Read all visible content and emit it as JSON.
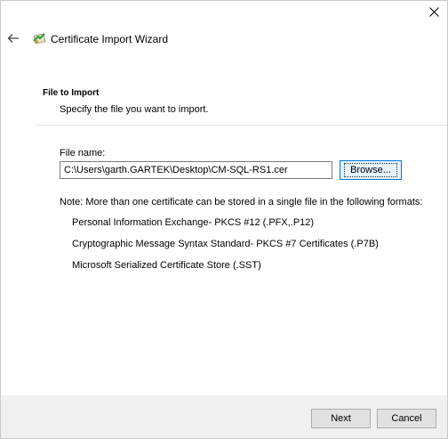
{
  "window": {
    "title": "Certificate Import Wizard"
  },
  "header": {
    "section_title": "File to Import",
    "section_subtitle": "Specify the file you want to import."
  },
  "file": {
    "label": "File name:",
    "value": "C:\\Users\\garth.GARTEK\\Desktop\\CM-SQL-RS1.cer",
    "browse_label": "Browse..."
  },
  "note": "Note:  More than one certificate can be stored in a single file in the following formats:",
  "formats": [
    "Personal Information Exchange- PKCS #12 (.PFX,.P12)",
    "Cryptographic Message Syntax Standard- PKCS #7 Certificates (.P7B)",
    "Microsoft Serialized Certificate Store (.SST)"
  ],
  "footer": {
    "next_label": "Next",
    "cancel_label": "Cancel"
  },
  "icons": {
    "close": "close-icon",
    "back": "back-arrow-icon",
    "wizard": "certificate-icon"
  },
  "colors": {
    "accent": "#0078d7",
    "footer_bg": "#f0f0f0"
  }
}
